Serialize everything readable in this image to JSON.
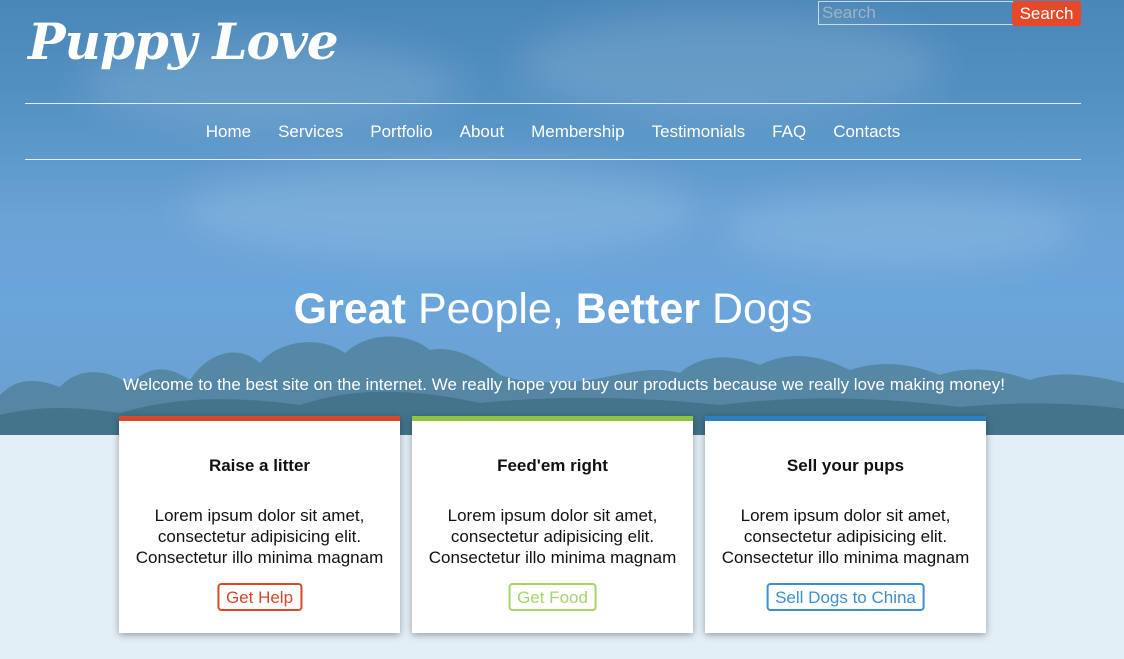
{
  "brand": {
    "logo": "Puppy Love"
  },
  "search": {
    "placeholder": "Search",
    "button": "Search"
  },
  "nav": {
    "items": [
      "Home",
      "Services",
      "Portfolio",
      "About",
      "Membership",
      "Testimonials",
      "FAQ",
      "Contacts"
    ]
  },
  "hero": {
    "headline": {
      "w1": "Great",
      "w2": " People, ",
      "w3": "Better",
      "w4": " Dogs"
    },
    "tagline": "Welcome to the best site on the internet. We really hope you buy our products because we really love making money!"
  },
  "cards": [
    {
      "title": "Raise a litter",
      "line1": "Lorem ipsum dolor sit amet,",
      "line2": "consectetur adipisicing elit.",
      "line3": "Consectetur illo minima magnam",
      "button": "Get Help",
      "accent": "#d9472b"
    },
    {
      "title": "Feed'em right",
      "line1": "Lorem ipsum dolor sit amet,",
      "line2": "consectetur adipisicing elit.",
      "line3": "Consectetur illo minima magnam",
      "button": "Get Food",
      "accent": "#8dc63f"
    },
    {
      "title": "Sell your pups",
      "line1": "Lorem ipsum dolor sit amet,",
      "line2": "consectetur adipisicing elit.",
      "line3": "Consectetur illo minima magnam",
      "button": "Sell Dogs to China",
      "accent": "#2a7fc1"
    }
  ],
  "colors": {
    "search_button": "#e5492a",
    "page_background": "#e3eff7",
    "get_help_text": "#d9472b",
    "get_food_text": "#a6d46b",
    "sell_dogs_text": "#3b8fd1"
  }
}
